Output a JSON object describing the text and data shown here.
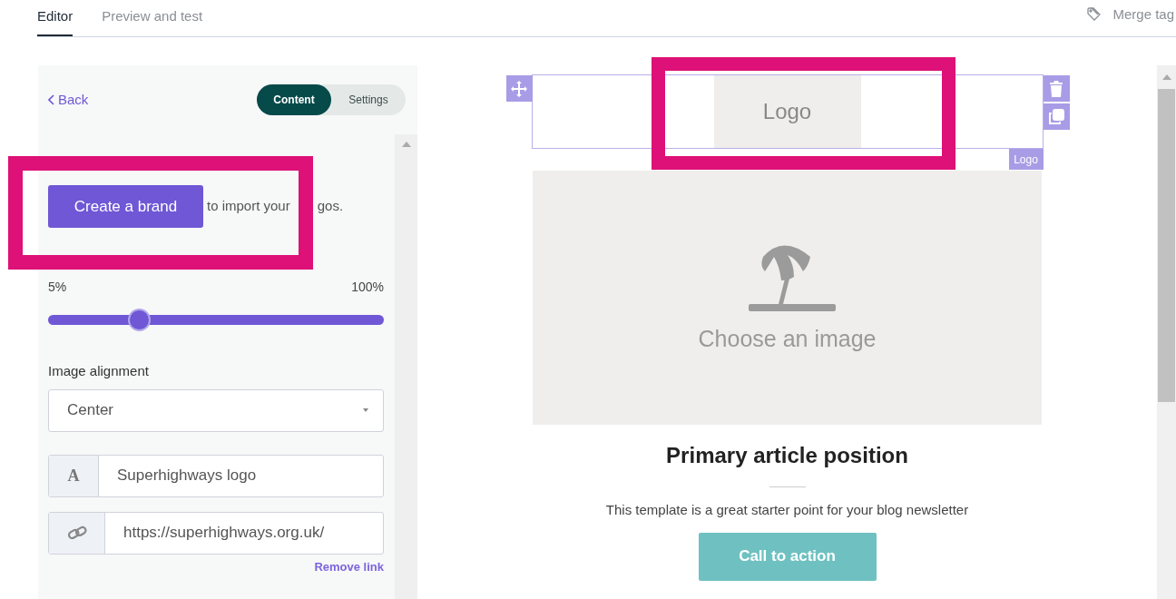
{
  "tabs": [
    {
      "label": "Editor",
      "selected": true
    },
    {
      "label": "Preview and test",
      "selected": false
    }
  ],
  "merge_tags": "Merge tag",
  "panel": {
    "back": "Back",
    "toggle": [
      {
        "label": "Content",
        "selected": true
      },
      {
        "label": "Settings",
        "selected": false
      }
    ],
    "create_brand": "Create a brand",
    "import_text_start": "to import your",
    "import_text_end": "gos.",
    "slider": {
      "min_label": "5%",
      "max_label": "100%",
      "level": 0.27
    },
    "alignment_label": "Image alignment",
    "alignment_value": "Center",
    "alt_text": {
      "addon": "A",
      "value": "Superhighways logo"
    },
    "link": {
      "value": "https://superhighways.org.uk/"
    },
    "remove_link": "Remove link"
  },
  "email": {
    "logo_placeholder": "Logo",
    "logo_tag": "Logo",
    "image_placeholder": "Choose an image",
    "heading": "Primary article position",
    "body": "This template is a great starter point for your blog newsletter",
    "cta": "Call to action"
  }
}
